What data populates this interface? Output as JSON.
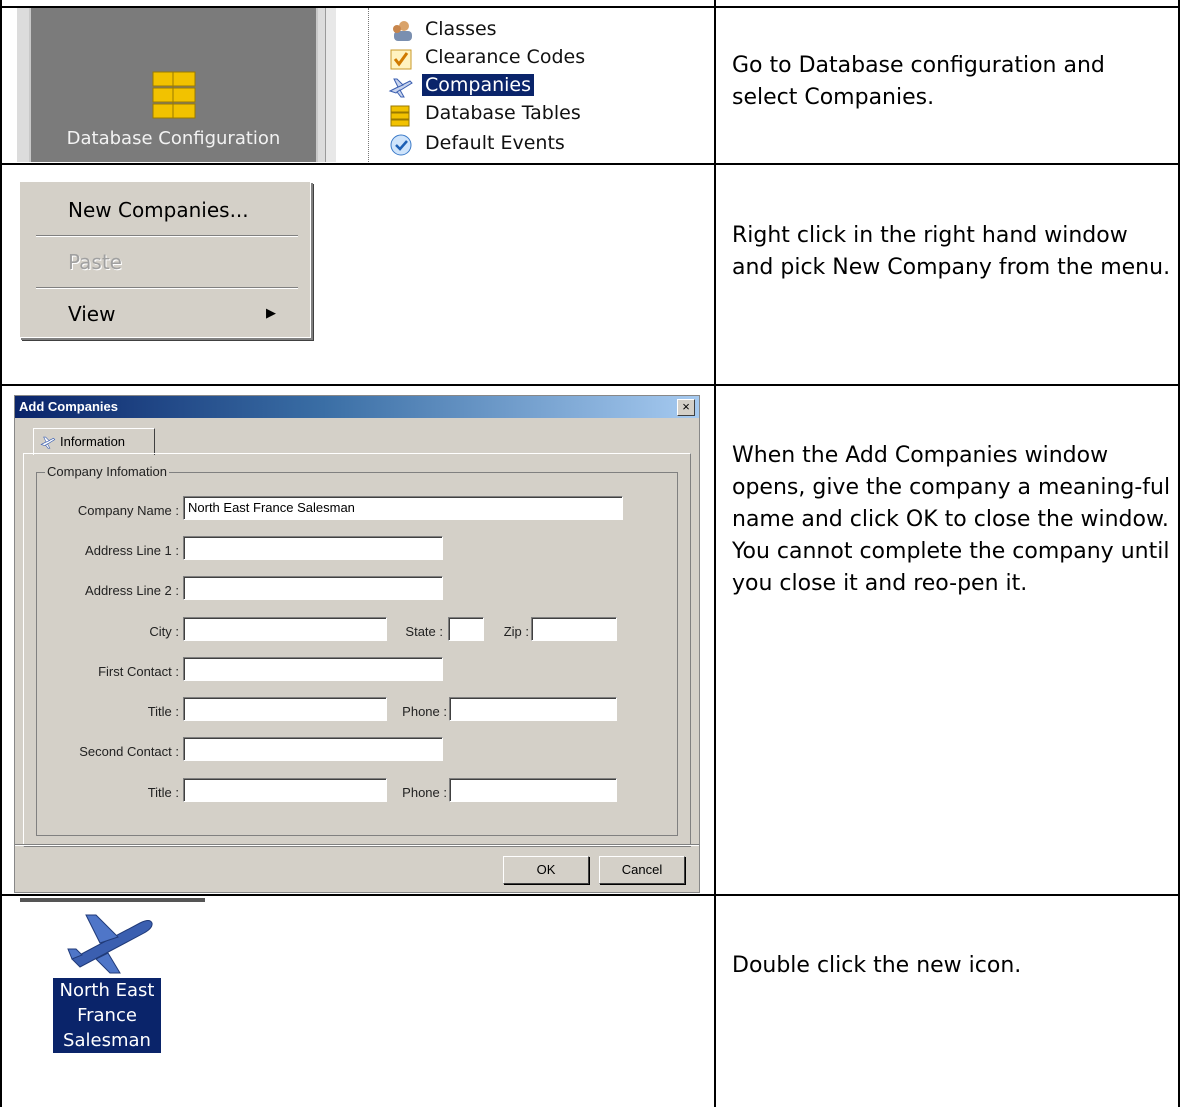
{
  "row1": {
    "panel_label": "Database Configuration",
    "tree_items": [
      {
        "label": "Classes",
        "icon": "classes-icon"
      },
      {
        "label": "Clearance Codes",
        "icon": "clearance-codes-icon"
      },
      {
        "label": "Companies",
        "icon": "airplane-icon",
        "selected": true
      },
      {
        "label": "Database Tables",
        "icon": "database-tables-icon"
      },
      {
        "label": "Default Events",
        "icon": "check-circle-icon"
      }
    ],
    "instruction": "Go to Database configuration and select Companies."
  },
  "row2": {
    "menu_items": [
      "New Companies...",
      "Paste",
      "View"
    ],
    "submenu_arrow": "▶",
    "instruction": "Right click in the right hand window and pick New Company from the menu."
  },
  "row3": {
    "dialog_title": "Add Companies",
    "close_glyph": "×",
    "tab_label": "Information",
    "group_title": "Company Infomation",
    "labels": {
      "company_name": "Company Name :",
      "address1": "Address Line 1 :",
      "address2": "Address Line 2 :",
      "city": "City :",
      "state": "State :",
      "zip": "Zip :",
      "first_contact": "First Contact :",
      "title1": "Title :",
      "phone1": "Phone :",
      "second_contact": "Second Contact :",
      "title2": "Title :",
      "phone2": "Phone :"
    },
    "values": {
      "company_name": "North East France Salesman"
    },
    "ok_label": "OK",
    "cancel_label": "Cancel",
    "instruction": "When the Add Companies window opens, give the company a meaning-ful name and click OK to close the window. You cannot complete the company until you close it and reo-pen it."
  },
  "row4": {
    "icon_label_lines": [
      "North East",
      "France",
      "Salesman"
    ],
    "instruction": "Double click the new icon."
  },
  "colors": {
    "selection": "#0a246a",
    "dialog_bg": "#d4d0c8",
    "panel_bg": "#7b7b7b",
    "db_icon": "#f2c200",
    "plane_icon": "#3b5fb0"
  }
}
